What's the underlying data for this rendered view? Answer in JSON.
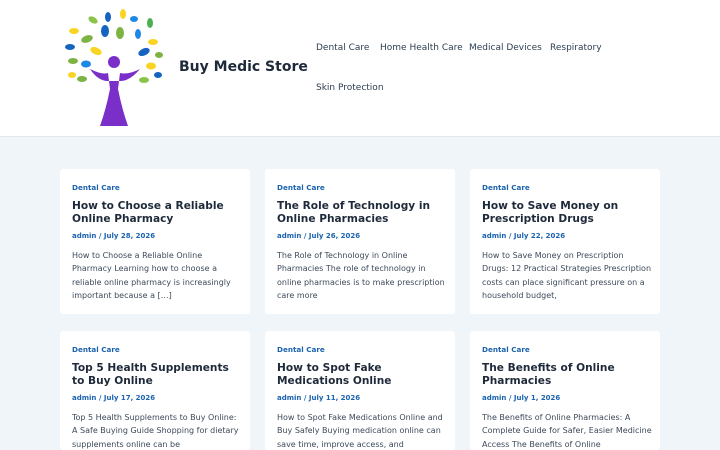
{
  "site": {
    "title": "Buy Medic Store"
  },
  "nav": [
    {
      "label": "Dental Care"
    },
    {
      "label": "Home Health Care"
    },
    {
      "label": "Medical Devices"
    },
    {
      "label": "Respiratory"
    },
    {
      "label": "Skin Protection"
    }
  ],
  "posts": [
    {
      "category": "Dental Care",
      "title": "How to Choose a Reliable Online Pharmacy",
      "author": "admin",
      "date": "July 28, 2026",
      "excerpt": "How to Choose a Reliable Online Pharmacy Learning how to choose a reliable online pharmacy is increasingly important because a […]"
    },
    {
      "category": "Dental Care",
      "title": "The Role of Technology in Online Pharmacies",
      "author": "admin",
      "date": "July 26, 2026",
      "excerpt": "The Role of Technology in Online Pharmacies The role of technology in online pharmacies is to make prescription care more"
    },
    {
      "category": "Dental Care",
      "title": "How to Save Money on Prescription Drugs",
      "author": "admin",
      "date": "July 22, 2026",
      "excerpt": "How to Save Money on Prescription Drugs: 12 Practical Strategies Prescription costs can place significant pressure on a household budget,"
    },
    {
      "category": "Dental Care",
      "title": "Top 5 Health Supplements to Buy Online",
      "author": "admin",
      "date": "July 17, 2026",
      "excerpt": "Top 5 Health Supplements to Buy Online: A Safe Buying Guide Shopping for dietary supplements online can be"
    },
    {
      "category": "Dental Care",
      "title": "How to Spot Fake Medications Online",
      "author": "admin",
      "date": "July 11, 2026",
      "excerpt": "How to Spot Fake Medications Online and Buy Safely Buying medication online can save time, improve access, and"
    },
    {
      "category": "Dental Care",
      "title": "The Benefits of Online Pharmacies",
      "author": "admin",
      "date": "July 1, 2026",
      "excerpt": "The Benefits of Online Pharmacies: A Complete Guide for Safer, Easier Medicine Access The Benefits of Online"
    }
  ],
  "meta_separator": "/",
  "colors": {
    "accent": "#1b63b0",
    "background": "#f0f5fa",
    "card": "#ffffff",
    "logo_figure": "#7b2fc9"
  }
}
